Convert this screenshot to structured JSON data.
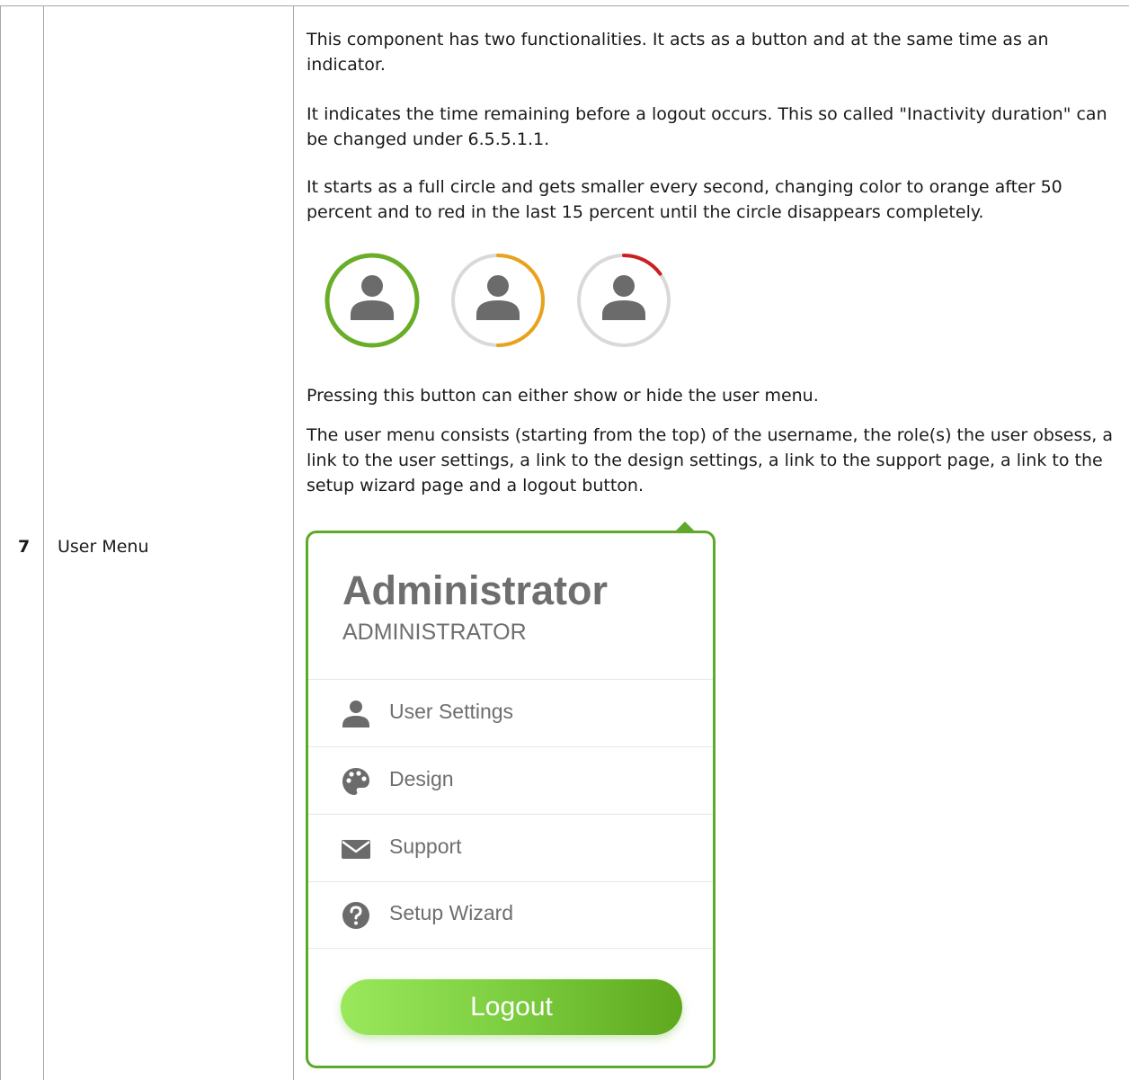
{
  "row": {
    "number": "7",
    "name": "User Menu"
  },
  "description": {
    "p1": "This component has two functionalities. It acts as a button and at the same time as an indicator.",
    "p2": "It indicates the time remaining before a logout occurs. This so called \"Inactivity duration\" can be changed under 6.5.5.1.1.",
    "p3": "It starts as a full circle and gets smaller every second, changing color to orange after 50 percent and to red in the last 15 percent until the circle disappears completely.",
    "p4": "Pressing this button can either show or hide the user menu.",
    "p5": "The user menu consists (starting from the top) of the username, the role(s) the user obsess, a link to the user settings, a link to the design settings, a link to the support page, a link to the setup wizard page and a logout button."
  },
  "indicators": [
    {
      "remaining_percent": 100,
      "color": "#6aae28"
    },
    {
      "remaining_percent": 50,
      "color": "#e8a21c"
    },
    {
      "remaining_percent": 15,
      "color": "#cc1f1f"
    }
  ],
  "colors": {
    "track": "#d9d9d9",
    "avatar": "#6b6b6b",
    "accent": "#5ea82a"
  },
  "user_menu": {
    "username": "Administrator",
    "role": "ADMINISTRATOR",
    "items": [
      {
        "label": "User Settings",
        "icon": "user-icon"
      },
      {
        "label": "Design",
        "icon": "palette-icon"
      },
      {
        "label": "Support",
        "icon": "envelope-icon"
      },
      {
        "label": "Setup Wizard",
        "icon": "question-circle-icon"
      }
    ],
    "logout_label": "Logout"
  }
}
